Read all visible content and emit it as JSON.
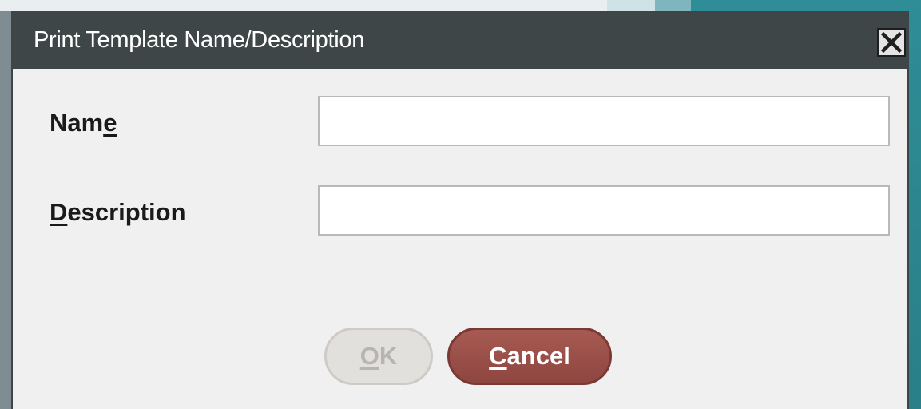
{
  "dialog": {
    "title": "Print Template Name/Description"
  },
  "fields": {
    "name": {
      "label_pre": "Nam",
      "label_mnemonic": "e",
      "label_post": "",
      "value": "",
      "placeholder": ""
    },
    "description": {
      "label_pre": "",
      "label_mnemonic": "D",
      "label_post": "escription",
      "value": "",
      "placeholder": ""
    }
  },
  "buttons": {
    "ok": {
      "mnemonic": "O",
      "rest": "K",
      "enabled": false
    },
    "cancel": {
      "mnemonic": "C",
      "rest": "ancel",
      "enabled": true
    }
  },
  "colors": {
    "titlebar": "#3f4647",
    "dialog_bg": "#f0f0f0",
    "cancel_button": "#9e534c",
    "ok_disabled": "#e2e0dd"
  },
  "icons": {
    "close": "close-icon"
  }
}
